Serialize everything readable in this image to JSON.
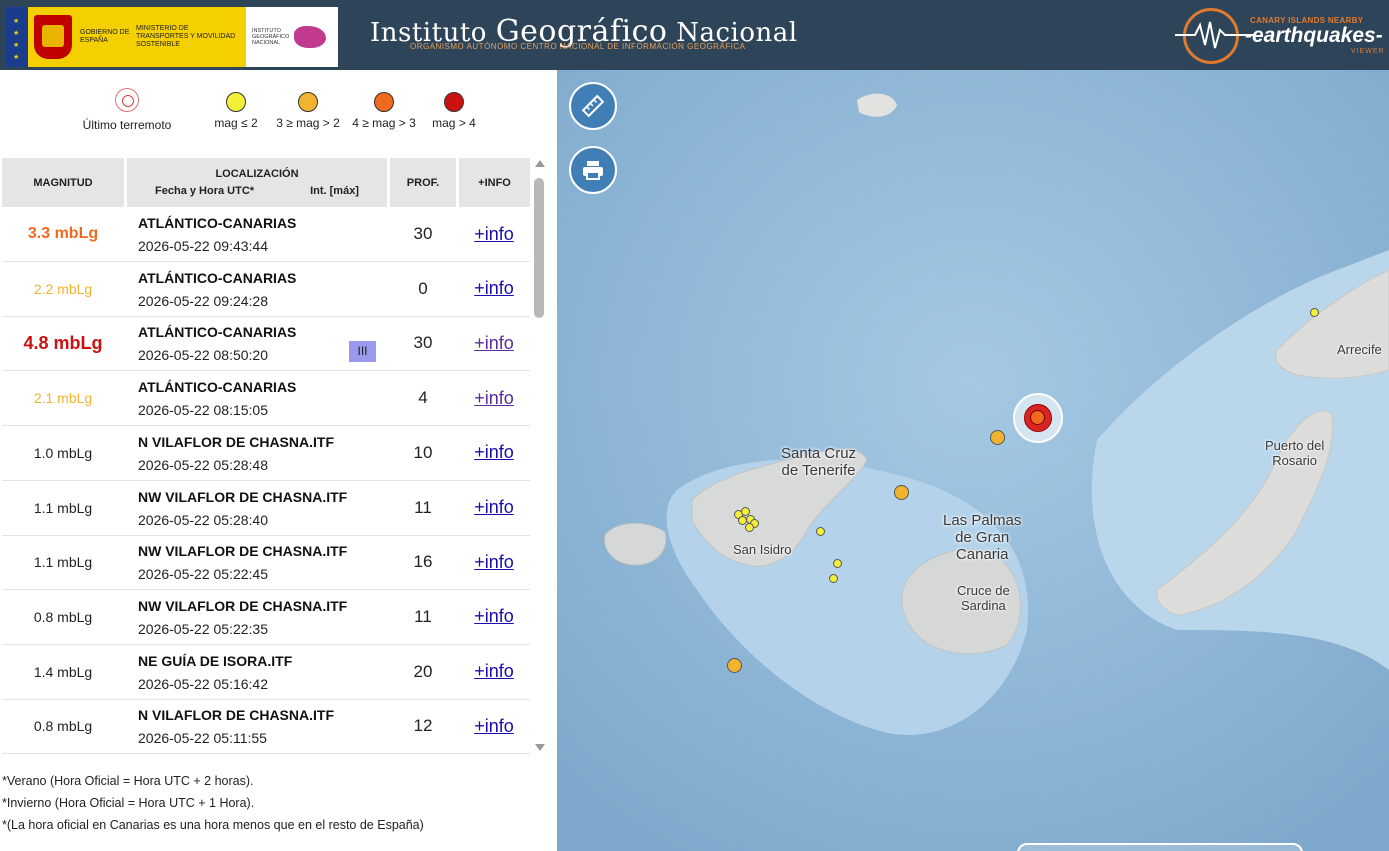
{
  "header": {
    "gov_text": "GOBIERNO DE ESPAÑA",
    "ministry_text": "MINISTERIO DE TRANSPORTES Y MOVILIDAD SOSTENIBLE",
    "ign_small_text": "INSTITUTO GEOGRÁFICO NACIONAL",
    "title_part1": "Instituto ",
    "title_part2": "Geográfico",
    "title_part3": " Nacional",
    "subtitle": "ORGANISMO AUTÓNOMO CENTRO NACIONAL DE INFORMACIÓN GEOGRÁFICA",
    "eq_top": "CANARY ISLANDS NEARBY",
    "eq_main": "-earthquakes-",
    "eq_bottom": "VIEWER"
  },
  "legend": {
    "last": "Último terremoto",
    "mag1": "mag ≤ 2",
    "mag2": "3 ≥ mag > 2",
    "mag3": "4 ≥ mag > 3",
    "mag4": "mag > 4",
    "colors": {
      "mag1": "#f4f03a",
      "mag2": "#f2b32e",
      "mag3": "#ef6a1e",
      "mag4": "#cc1111"
    }
  },
  "table": {
    "headers": {
      "magnitude": "MAGNITUD",
      "location": "LOCALIZACIÓN",
      "datetime": "Fecha y Hora UTC*",
      "intensity": "Int. [máx]",
      "depth": "PROF.",
      "info": "+INFO"
    },
    "rows": [
      {
        "mag": "3.3 mbLg",
        "name": "ATLÁNTICO-CANARIAS",
        "date": "2026-05-22 09:43:44",
        "depth": "30",
        "info": "+info",
        "intensity": ""
      },
      {
        "mag": "2.2 mbLg",
        "name": "ATLÁNTICO-CANARIAS",
        "date": "2026-05-22 09:24:28",
        "depth": "0",
        "info": "+info",
        "intensity": ""
      },
      {
        "mag": "4.8 mbLg",
        "name": "ATLÁNTICO-CANARIAS",
        "date": "2026-05-22 08:50:20",
        "depth": "30",
        "info": "+info",
        "intensity": "III"
      },
      {
        "mag": "2.1 mbLg",
        "name": "ATLÁNTICO-CANARIAS",
        "date": "2026-05-22 08:15:05",
        "depth": "4",
        "info": "+info",
        "intensity": ""
      },
      {
        "mag": "1.0 mbLg",
        "name": "N VILAFLOR DE CHASNA.ITF",
        "date": "2026-05-22 05:28:48",
        "depth": "10",
        "info": "+info",
        "intensity": ""
      },
      {
        "mag": "1.1 mbLg",
        "name": "NW VILAFLOR DE CHASNA.ITF",
        "date": "2026-05-22 05:28:40",
        "depth": "11",
        "info": "+info",
        "intensity": ""
      },
      {
        "mag": "1.1 mbLg",
        "name": "NW VILAFLOR DE CHASNA.ITF",
        "date": "2026-05-22 05:22:45",
        "depth": "16",
        "info": "+info",
        "intensity": ""
      },
      {
        "mag": "0.8 mbLg",
        "name": "NW VILAFLOR DE CHASNA.ITF",
        "date": "2026-05-22 05:22:35",
        "depth": "11",
        "info": "+info",
        "intensity": ""
      },
      {
        "mag": "1.4 mbLg",
        "name": "NE GUÍA DE ISORA.ITF",
        "date": "2026-05-22 05:16:42",
        "depth": "20",
        "info": "+info",
        "intensity": ""
      },
      {
        "mag": "0.8 mbLg",
        "name": "N VILAFLOR DE CHASNA.ITF",
        "date": "2026-05-22 05:11:55",
        "depth": "12",
        "info": "+info",
        "intensity": ""
      }
    ]
  },
  "notes": [
    "*Verano (Hora Oficial = Hora UTC + 2 horas).",
    "*Invierno (Hora Oficial = Hora UTC + 1 Hora).",
    "*(La hora oficial en Canarias es una hora menos que en el resto de España)"
  ],
  "map": {
    "places": {
      "arrecife": "Arrecife",
      "puerto1": "Puerto del",
      "puerto2": "Rosario",
      "santa1": "Santa Cruz",
      "santa2": "de Tenerife",
      "palmas1": "Las Palmas",
      "palmas2": "de Gran",
      "palmas3": "Canaria",
      "cruz1": "Cruce de",
      "cruz2": "Sardina",
      "isidro": "San Isidro"
    }
  }
}
